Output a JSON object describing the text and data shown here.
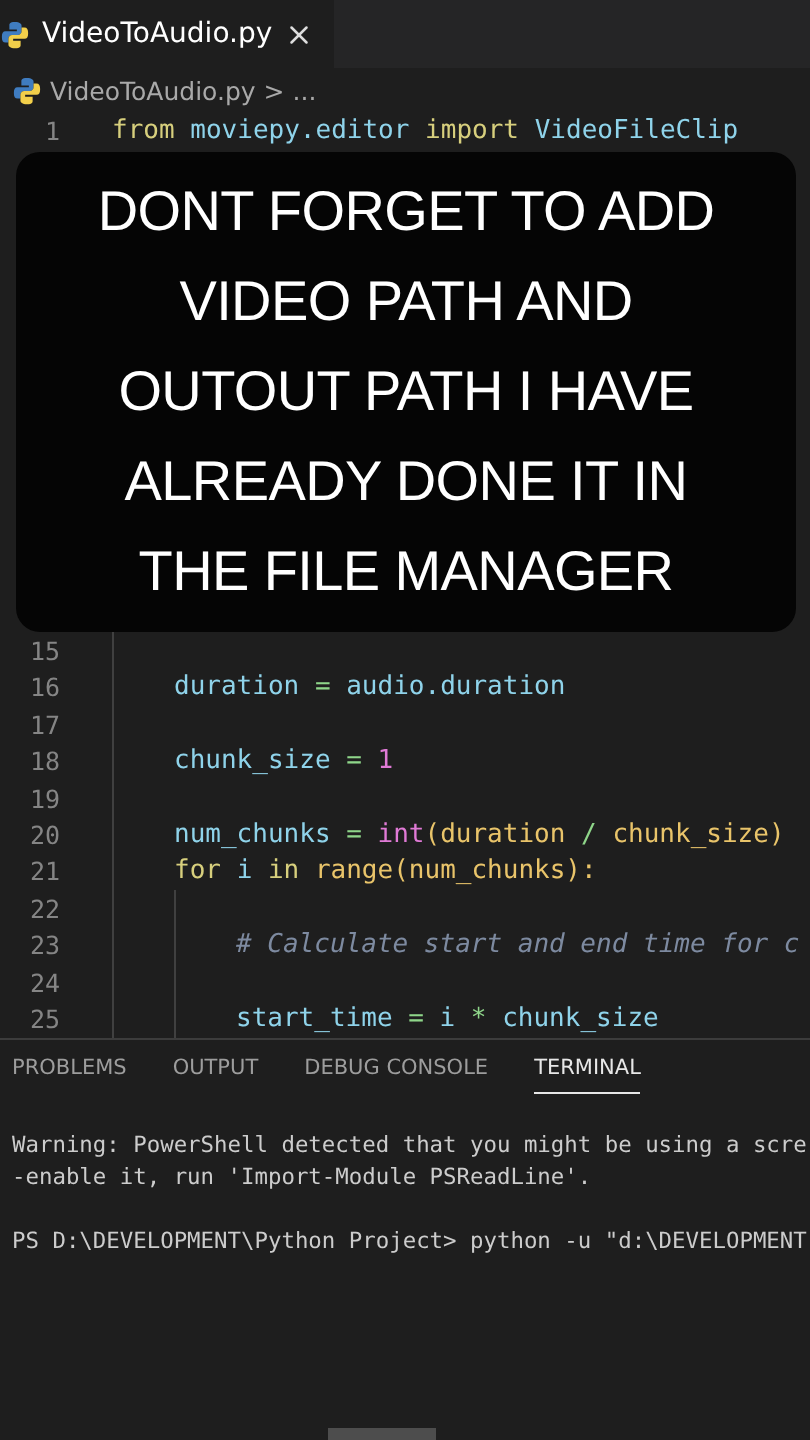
{
  "tabs": [
    {
      "label": "VideoToAudio.py",
      "selected": true
    }
  ],
  "breadcrumb": {
    "file": "VideoToAudio.py",
    "separator": ">",
    "rest": "..."
  },
  "code_lines": [
    {
      "kind": "top",
      "number": "1",
      "tokens": [
        {
          "kind": "keyword",
          "text": "from "
        },
        {
          "kind": "variable",
          "text": "moviepy.editor "
        },
        {
          "kind": "keyword",
          "text": "import "
        },
        {
          "kind": "variable",
          "text": "VideoFileClip"
        }
      ]
    },
    {
      "kind": "caption",
      "text": "DONT FORGET TO ADD VIDEO PATH AND OUTOUT PATH I HAVE ALREADY DONE IT IN THE FILE MANAGER"
    },
    {
      "kind": "block",
      "number": "15"
    },
    {
      "kind": "block",
      "number": "16",
      "tokens": [
        {
          "kind": "variable",
          "text": "duration"
        },
        {
          "kind": "operator",
          "text": " = "
        },
        {
          "kind": "variable",
          "text": "audio.duration"
        }
      ]
    },
    {
      "kind": "block",
      "number": "17"
    },
    {
      "kind": "block",
      "number": "18",
      "tokens": [
        {
          "kind": "variable",
          "text": "chunk_size"
        },
        {
          "kind": "operator",
          "text": " = "
        },
        {
          "kind": "number",
          "text": "1"
        }
      ]
    },
    {
      "kind": "block",
      "number": "19"
    },
    {
      "kind": "block",
      "number": "20",
      "tokens": [
        {
          "kind": "variable",
          "text": "num_chunks"
        },
        {
          "kind": "operator",
          "text": " = "
        },
        {
          "kind": "builtin",
          "text": "int"
        },
        {
          "kind": "paren",
          "text": "(duration"
        },
        {
          "kind": "operator",
          "text": " / "
        },
        {
          "kind": "paren",
          "text": "chunk_size)"
        }
      ]
    },
    {
      "kind": "block",
      "number": "21",
      "tokens": [
        {
          "kind": "keyword",
          "text": "for "
        },
        {
          "kind": "variable",
          "text": "i "
        },
        {
          "kind": "keyword",
          "text": "in "
        },
        {
          "kind": "function",
          "text": "range"
        },
        {
          "kind": "paren",
          "text": "(num_chunks):"
        }
      ]
    },
    {
      "kind": "nested",
      "number": "22"
    },
    {
      "kind": "nested",
      "number": "23",
      "tokens": [
        {
          "kind": "comment",
          "text": "# Calculate start and end time for c"
        }
      ]
    },
    {
      "kind": "nested",
      "number": "24"
    },
    {
      "kind": "nested",
      "number": "25",
      "tokens": [
        {
          "kind": "variable",
          "text": "start_time"
        },
        {
          "kind": "operator",
          "text": " = "
        },
        {
          "kind": "variable",
          "text": "i"
        },
        {
          "kind": "operator",
          "text": " * "
        },
        {
          "kind": "variable",
          "text": "chunk_size"
        }
      ]
    }
  ],
  "panel_tabs": [
    {
      "label": "PROBLEMS",
      "selected": false
    },
    {
      "label": "OUTPUT",
      "selected": false
    },
    {
      "label": "DEBUG CONSOLE",
      "selected": false
    },
    {
      "label": "TERMINAL",
      "selected": true
    }
  ],
  "terminal_lines": [
    "Warning: PowerShell detected that you might be using a scre",
    "-enable it, run 'Import-Module PSReadLine'.",
    "PS D:\\DEVELOPMENT\\Python Project> python -u \"d:\\DEVELOPMENT"
  ]
}
